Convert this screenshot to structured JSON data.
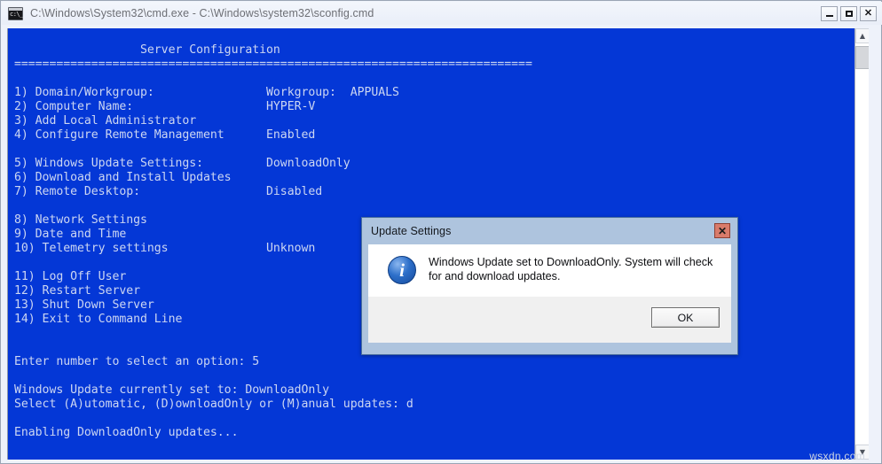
{
  "window": {
    "title": "C:\\Windows\\System32\\cmd.exe - C:\\Windows\\system32\\sconfig.cmd",
    "icon": "cmd-console-icon",
    "controls": {
      "minimize": "minimize-icon",
      "maximize": "maximize-icon",
      "close": "close-icon"
    }
  },
  "console": {
    "colors": {
      "background": "#0437d6",
      "foreground": "#ccd6f2"
    },
    "header": "                  Server Configuration",
    "separator": "==========================================================================",
    "menu": [
      {
        "num": "1)",
        "label": "Domain/Workgroup:",
        "value": "Workgroup:  APPUALS"
      },
      {
        "num": "2)",
        "label": "Computer Name:",
        "value": "HYPER-V"
      },
      {
        "num": "3)",
        "label": "Add Local Administrator",
        "value": ""
      },
      {
        "num": "4)",
        "label": "Configure Remote Management",
        "value": "Enabled"
      },
      {
        "num": "",
        "label": "",
        "value": ""
      },
      {
        "num": "5)",
        "label": "Windows Update Settings:",
        "value": "DownloadOnly"
      },
      {
        "num": "6)",
        "label": "Download and Install Updates",
        "value": ""
      },
      {
        "num": "7)",
        "label": "Remote Desktop:",
        "value": "Disabled"
      },
      {
        "num": "",
        "label": "",
        "value": ""
      },
      {
        "num": "8)",
        "label": "Network Settings",
        "value": ""
      },
      {
        "num": "9)",
        "label": "Date and Time",
        "value": ""
      },
      {
        "num": "10)",
        "label": "Telemetry settings",
        "value": "Unknown"
      },
      {
        "num": "",
        "label": "",
        "value": ""
      },
      {
        "num": "11)",
        "label": "Log Off User",
        "value": ""
      },
      {
        "num": "12)",
        "label": "Restart Server",
        "value": ""
      },
      {
        "num": "13)",
        "label": "Shut Down Server",
        "value": ""
      },
      {
        "num": "14)",
        "label": "Exit to Command Line",
        "value": ""
      }
    ],
    "prompt_lines": [
      "",
      "",
      "Enter number to select an option: 5",
      "",
      "Windows Update currently set to: DownloadOnly",
      "Select (A)utomatic, (D)ownloadOnly or (M)anual updates: d",
      "",
      "Enabling DownloadOnly updates..."
    ],
    "full_text": "                  Server Configuration\n==========================================================================\n\n1) Domain/Workgroup:                Workgroup:  APPUALS\n2) Computer Name:                   HYPER-V\n3) Add Local Administrator\n4) Configure Remote Management      Enabled\n\n5) Windows Update Settings:         DownloadOnly\n6) Download and Install Updates\n7) Remote Desktop:                  Disabled\n\n8) Network Settings\n9) Date and Time\n10) Telemetry settings              Unknown\n\n11) Log Off User\n12) Restart Server\n13) Shut Down Server\n14) Exit to Command Line\n\n\nEnter number to select an option: 5\n\nWindows Update currently set to: DownloadOnly\nSelect (A)utomatic, (D)ownloadOnly or (M)anual updates: d\n\nEnabling DownloadOnly updates..."
  },
  "scrollbar": {
    "up_arrow": "chevron-up-icon",
    "down_arrow": "chevron-down-icon"
  },
  "dialog": {
    "title": "Update Settings",
    "close_label": "✕",
    "icon": "info-icon",
    "message": "Windows Update set to DownloadOnly.  System will check for and download updates.",
    "ok_label": "OK",
    "accent_close_color": "#d97b6b"
  },
  "watermark": "wsxdn.com"
}
